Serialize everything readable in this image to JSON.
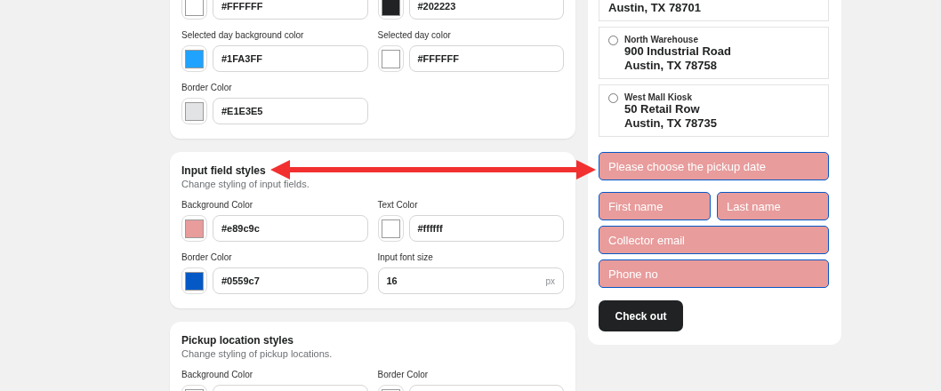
{
  "sections": [
    {
      "fields": [
        {
          "kind": "color",
          "value": "#FFFFFF"
        },
        {
          "kind": "color",
          "value": "#202223"
        },
        {
          "kind": "color",
          "label": "Selected day background color",
          "value": "#1FA3FF"
        },
        {
          "kind": "color",
          "label": "Selected day color",
          "value": "#FFFFFF"
        },
        {
          "kind": "color",
          "label": "Border Color",
          "value": "#E1E3E5"
        }
      ]
    },
    {
      "title": "Input field styles",
      "subtitle": "Change styling of input fields.",
      "fields": [
        {
          "kind": "color",
          "label": "Background Color",
          "value": "#e89c9c"
        },
        {
          "kind": "color",
          "label": "Text Color",
          "value": "#ffffff"
        },
        {
          "kind": "color",
          "label": "Border Color",
          "value": "#0559c7"
        },
        {
          "kind": "number",
          "label": "Input font size",
          "value": "16",
          "unit": "px"
        }
      ]
    },
    {
      "title": "Pickup location styles",
      "subtitle": "Change styling of pickup locations.",
      "fields": [
        {
          "kind": "color",
          "label": "Background Color"
        },
        {
          "kind": "color",
          "label": "Border Color"
        }
      ]
    }
  ],
  "preview": {
    "locations": [
      {
        "lines": [
          "Austin, TX 78701"
        ]
      },
      {
        "name": "North Warehouse",
        "lines": [
          "900 Industrial Road",
          "Austin, TX 78758"
        ],
        "selected": false
      },
      {
        "name": "West Mall Kiosk",
        "lines": [
          "50 Retail Row",
          "Austin, TX 78735"
        ],
        "selected": false
      }
    ],
    "date_placeholder": "Please choose the pickup date",
    "first_name_placeholder": "First name",
    "last_name_placeholder": "Last name",
    "email_placeholder": "Collector email",
    "phone_placeholder": "Phone no",
    "button": "Check out"
  }
}
